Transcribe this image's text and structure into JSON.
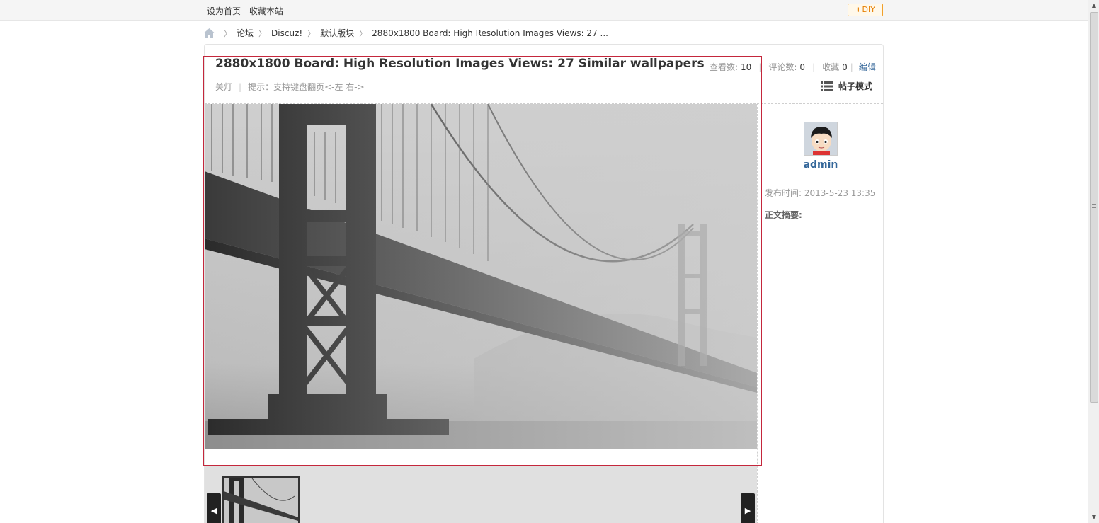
{
  "topbar": {
    "set_homepage": "设为首页",
    "bookmark": "收藏本站",
    "diy_label": "DIY"
  },
  "breadcrumb": {
    "items": [
      "论坛",
      "Discuz!",
      "默认版块",
      "2880x1800 Board: High Resolution Images Views: 27 ..."
    ]
  },
  "post": {
    "title": "2880x1800 Board: High Resolution Images Views: 27 Similar wallpapers",
    "light_off": "关灯",
    "hint": "提示：支持键盘翻页<-左 右->",
    "views_label": "查看数:",
    "views_value": "10",
    "comments_label": "评论数:",
    "comments_value": "0",
    "favorites_label": "收藏",
    "favorites_value": "0",
    "edit_label": "编辑",
    "mode_label": "帖子模式"
  },
  "sidebar": {
    "author": "admin",
    "pubtime": "发布时间: 2013-5-23 13:35",
    "summary_label": "正文摘要:"
  },
  "colors": {
    "accent": "#336699",
    "focus_border": "#c4273c",
    "diy": "#e67e00"
  },
  "icons": [
    "home-icon",
    "list-icon",
    "arrow-down-icon",
    "chevron-left-icon",
    "chevron-right-icon"
  ]
}
